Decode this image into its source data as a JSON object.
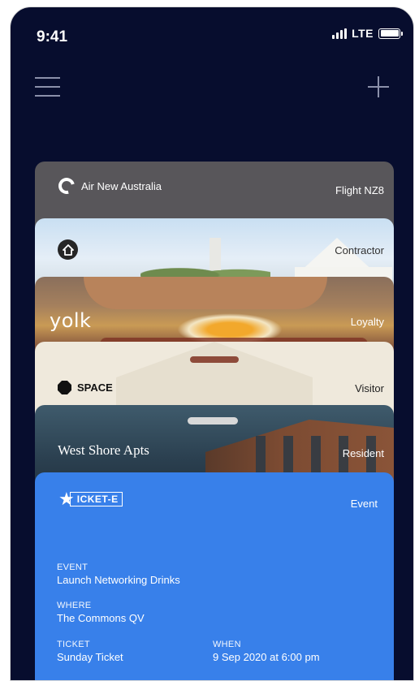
{
  "status_bar": {
    "time": "9:41",
    "network": "LTE"
  },
  "icons": {
    "menu": "hamburger-menu-icon",
    "add": "plus-icon",
    "signal": "signal-bars-icon",
    "battery": "battery-icon"
  },
  "colors": {
    "background": "#070d2e",
    "ticket_card": "#3880ea",
    "airline_card": "#58565a",
    "space_card": "#efe9dc"
  },
  "cards": [
    {
      "brand": "Air New Australia",
      "type": "Flight NZ8"
    },
    {
      "brand": "",
      "type": "Contractor"
    },
    {
      "brand": "yolk",
      "type": "Loyalty"
    },
    {
      "brand": "SPACE",
      "type": "Visitor"
    },
    {
      "brand": "West Shore Apts",
      "type": "Resident"
    },
    {
      "brand": "ICKET-E",
      "type": "Event",
      "fields": {
        "event_label": "EVENT",
        "event_value": "Launch Networking Drinks",
        "where_label": "WHERE",
        "where_value": "The Commons QV",
        "ticket_label": "TICKET",
        "ticket_value": "Sunday Ticket",
        "when_label": "WHEN",
        "when_value": "9 Sep 2020 at 6:00 pm"
      }
    }
  ]
}
